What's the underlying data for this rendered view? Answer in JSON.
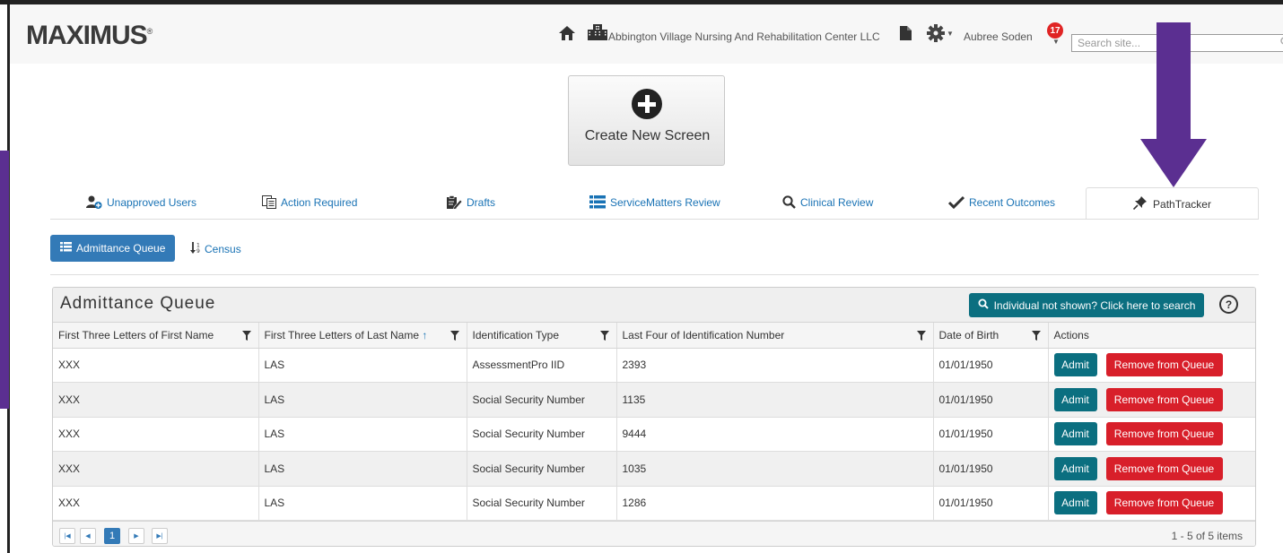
{
  "header": {
    "logo": "MAXIMUS",
    "logo_mark": "®",
    "facility": "Abbington Village Nursing And Rehabilitation Center LLC",
    "user": "Aubree Soden",
    "notification_count": "17",
    "search_placeholder": "Search site..."
  },
  "create_button": {
    "label": "Create New Screen"
  },
  "tabs": [
    {
      "label": "Unapproved Users"
    },
    {
      "label": "Action Required"
    },
    {
      "label": "Drafts"
    },
    {
      "label": "ServiceMatters Review"
    },
    {
      "label": "Clinical Review"
    },
    {
      "label": "Recent Outcomes"
    },
    {
      "label": "PathTracker"
    }
  ],
  "subnav": {
    "admittance": "Admittance Queue",
    "census": "Census"
  },
  "queue": {
    "title": "Admittance Queue",
    "search_button": "Individual not shown? Click here to search",
    "help": "?",
    "columns": [
      "First Three Letters of First Name",
      "First Three Letters of Last Name",
      "Identification Type",
      "Last Four of Identification Number",
      "Date of Birth",
      "Actions"
    ],
    "sort_indicator": "↑",
    "rows": [
      {
        "first": "XXX",
        "last": "LAS",
        "id_type": "AssessmentPro IID",
        "id_last4": "2393",
        "dob": "01/01/1950"
      },
      {
        "first": "XXX",
        "last": "LAS",
        "id_type": "Social Security Number",
        "id_last4": "1135",
        "dob": "01/01/1950"
      },
      {
        "first": "XXX",
        "last": "LAS",
        "id_type": "Social Security Number",
        "id_last4": "9444",
        "dob": "01/01/1950"
      },
      {
        "first": "XXX",
        "last": "LAS",
        "id_type": "Social Security Number",
        "id_last4": "1035",
        "dob": "01/01/1950"
      },
      {
        "first": "XXX",
        "last": "LAS",
        "id_type": "Social Security Number",
        "id_last4": "1286",
        "dob": "01/01/1950"
      }
    ],
    "admit_label": "Admit",
    "remove_label": "Remove from Queue",
    "pager": {
      "current_page": "1",
      "info": "1 - 5 of 5 items"
    }
  },
  "colors": {
    "brand_purple": "#5b2f91",
    "teal": "#0b6f80",
    "red": "#d81f2a",
    "blue": "#337ab7"
  }
}
